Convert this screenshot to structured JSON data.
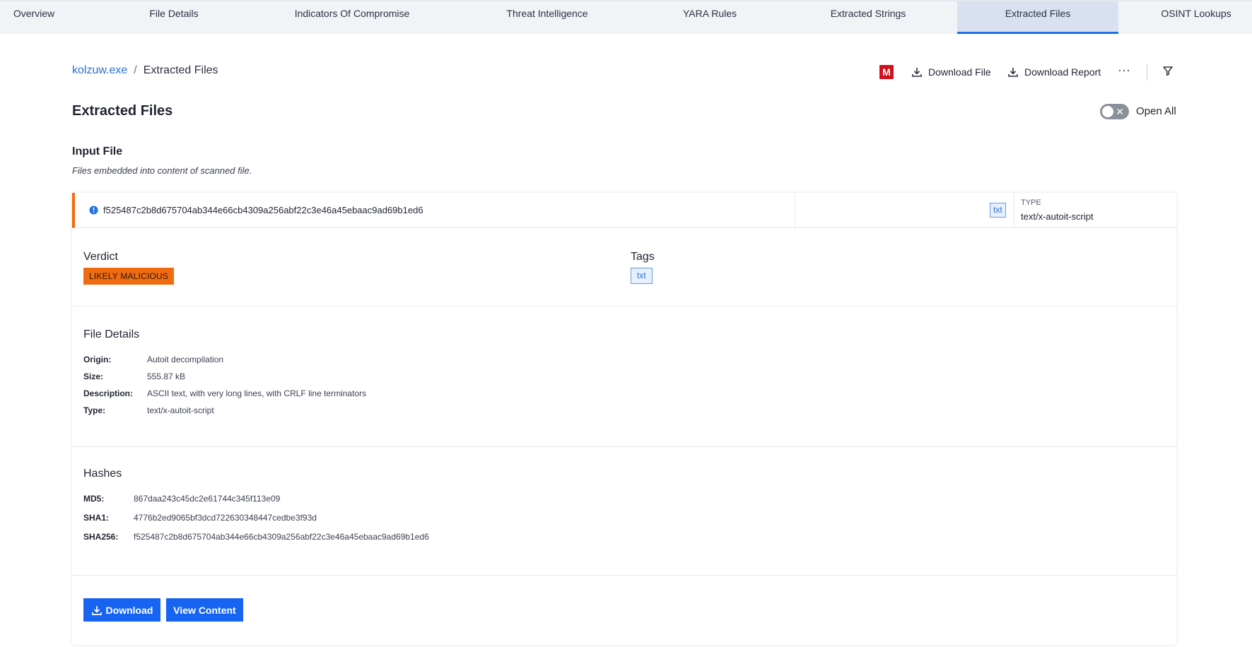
{
  "tabs": [
    {
      "label": "Overview",
      "active": false
    },
    {
      "label": "File Details",
      "active": false
    },
    {
      "label": "Indicators Of Compromise",
      "active": false
    },
    {
      "label": "Threat Intelligence",
      "active": false
    },
    {
      "label": "YARA Rules",
      "active": false
    },
    {
      "label": "Extracted Strings",
      "active": false
    },
    {
      "label": "Extracted Files",
      "active": true
    },
    {
      "label": "OSINT Lookups",
      "active": false
    }
  ],
  "breadcrumb": {
    "parent": "kolzuw.exe",
    "separator": "/",
    "current": "Extracted Files"
  },
  "toolbar": {
    "badge_letter": "M",
    "download_file_label": "Download File",
    "download_report_label": "Download Report",
    "more_label": "···"
  },
  "page": {
    "title": "Extracted Files",
    "toggle_label": "Open All",
    "toggle_on": false,
    "section_heading": "Input File",
    "section_description": "Files embedded into content of scanned file."
  },
  "file": {
    "hash": "f525487c2b8d675704ab344e66cb4309a256abf22c3e46a45ebaac9ad69b1ed6",
    "ext_chip": "txt",
    "type_label": "TYPE",
    "type_value": "text/x-autoit-script",
    "verdict_title": "Verdict",
    "verdict": "LIKELY MALICIOUS",
    "tags_title": "Tags",
    "tags": [
      "txt"
    ],
    "details_title": "File Details",
    "details": [
      {
        "key": "Origin:",
        "value": "Autoit decompilation"
      },
      {
        "key": "Size:",
        "value": "555.87 kB"
      },
      {
        "key": "Description:",
        "value": "ASCII text, with very long lines, with CRLF line terminators"
      },
      {
        "key": "Type:",
        "value": "text/x-autoit-script"
      }
    ],
    "hashes_title": "Hashes",
    "hashes": [
      {
        "key": "MD5:",
        "value": "867daa243c45dc2e61744c345f113e09"
      },
      {
        "key": "SHA1:",
        "value": "4776b2ed9065bf3dcd722630348447cedbe3f93d"
      },
      {
        "key": "SHA256:",
        "value": "f525487c2b8d675704ab344e66cb4309a256abf22c3e46a45ebaac9ad69b1ed6"
      }
    ],
    "download_label": "Download",
    "view_content_label": "View Content"
  },
  "colors": {
    "accent": "#1764f3",
    "link": "#2a6fd6",
    "verdict": "#f06b10",
    "badge": "#d0111b",
    "tab_active_bg": "#d9e1f1"
  }
}
